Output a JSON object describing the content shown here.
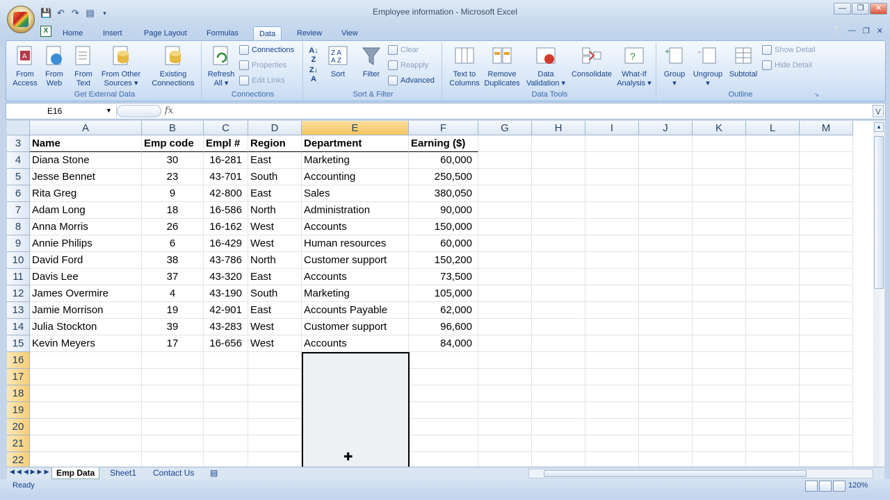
{
  "window": {
    "title": "Employee information - Microsoft Excel"
  },
  "quick_access": [
    "save-icon",
    "undo-icon",
    "redo-icon",
    "print-preview-icon",
    "customize-icon"
  ],
  "tabs": [
    "Home",
    "Insert",
    "Page Layout",
    "Formulas",
    "Data",
    "Review",
    "View"
  ],
  "active_tab": "Data",
  "ribbon": {
    "get_external": {
      "label": "Get External Data",
      "buttons": [
        "From Access",
        "From Web",
        "From Text",
        "From Other Sources",
        "Existing Connections"
      ]
    },
    "connections": {
      "label": "Connections",
      "refresh": "Refresh All",
      "items": [
        "Connections",
        "Properties",
        "Edit Links"
      ]
    },
    "sort_filter": {
      "label": "Sort & Filter",
      "sort": "Sort",
      "filter": "Filter",
      "items": [
        "Clear",
        "Reapply",
        "Advanced"
      ]
    },
    "data_tools": {
      "label": "Data Tools",
      "buttons": [
        "Text to Columns",
        "Remove Duplicates",
        "Data Validation",
        "Consolidate",
        "What-If Analysis"
      ]
    },
    "outline": {
      "label": "Outline",
      "buttons": [
        "Group",
        "Ungroup",
        "Subtotal"
      ],
      "items": [
        "Show Detail",
        "Hide Detail"
      ]
    }
  },
  "formula_bar": {
    "name_box": "E16",
    "fx": "fx",
    "value": ""
  },
  "columns": [
    "A",
    "B",
    "C",
    "D",
    "E",
    "F",
    "G",
    "H",
    "I",
    "J",
    "K",
    "L",
    "M"
  ],
  "selected_column": "E",
  "row_numbers": [
    "3",
    "4",
    "5",
    "6",
    "7",
    "8",
    "9",
    "10",
    "11",
    "12",
    "13",
    "14",
    "15",
    "16",
    "17",
    "18",
    "19",
    "20",
    "21",
    "22"
  ],
  "headers": [
    "Name",
    "Emp code",
    "Empl #",
    "Region",
    "Department",
    "Earning ($)"
  ],
  "rows": [
    [
      "Diana Stone",
      "30",
      "16-281",
      "East",
      "Marketing",
      "60,000"
    ],
    [
      "Jesse Bennet",
      "23",
      "43-701",
      "South",
      "Accounting",
      "250,500"
    ],
    [
      "Rita Greg",
      "9",
      "42-800",
      "East",
      "Sales",
      "380,050"
    ],
    [
      "Adam Long",
      "18",
      "16-586",
      "North",
      "Administration",
      "90,000"
    ],
    [
      "Anna Morris",
      "26",
      "16-162",
      "West",
      "Accounts",
      "150,000"
    ],
    [
      "Annie Philips",
      "6",
      "16-429",
      "West",
      "Human resources",
      "60,000"
    ],
    [
      "David Ford",
      "38",
      "43-786",
      "North",
      "Customer support",
      "150,200"
    ],
    [
      "Davis Lee",
      "37",
      "43-320",
      "East",
      "Accounts",
      "73,500"
    ],
    [
      "James Overmire",
      "4",
      "43-190",
      "South",
      "Marketing",
      "105,000"
    ],
    [
      "Jamie Morrison",
      "19",
      "42-901",
      "East",
      "Accounts Payable",
      "62,000"
    ],
    [
      "Julia Stockton",
      "39",
      "43-283",
      "West",
      "Customer support",
      "96,600"
    ],
    [
      "Kevin Meyers",
      "17",
      "16-656",
      "West",
      "Accounts",
      "84,000"
    ]
  ],
  "sheets": [
    "Emp Data",
    "Sheet1",
    "Contact Us"
  ],
  "active_sheet": "Emp Data",
  "status": {
    "ready": "Ready",
    "zoom": "120%"
  }
}
